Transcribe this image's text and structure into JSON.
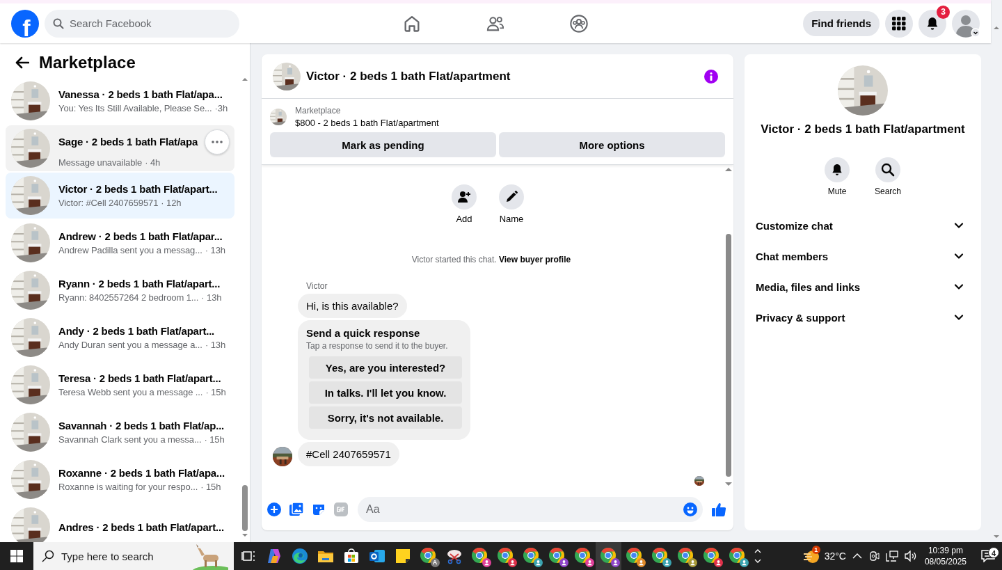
{
  "topbar": {
    "logo": "f",
    "search": {
      "placeholder": "Search Facebook"
    },
    "find_friends": "Find friends",
    "notifications_badge": "3"
  },
  "sidebar": {
    "title": "Marketplace",
    "conversations": [
      {
        "title": "Vanessa · 2 beds 1 bath Flat/apa...",
        "preview": "You: Yes Its Still Available, Please Se...",
        "time": "·3h",
        "selected": false,
        "hovered": false
      },
      {
        "title": "Sage · 2 beds 1 bath Flat/apa",
        "preview": "Message unavailable",
        "time": "· 4h",
        "selected": false,
        "hovered": true
      },
      {
        "title": "Victor · 2 beds 1 bath Flat/apart...",
        "preview": "Victor: #Cell 2407659571",
        "time": "· 12h",
        "selected": true,
        "hovered": false
      },
      {
        "title": "Andrew · 2 beds 1 bath Flat/apar...",
        "preview": "Andrew Padilla sent you a messag...",
        "time": "· 13h",
        "selected": false,
        "hovered": false
      },
      {
        "title": "Ryann · 2 beds 1 bath Flat/apart...",
        "preview": "Ryann: 8402557264 2 bedroom 1...",
        "time": "· 13h",
        "selected": false,
        "hovered": false
      },
      {
        "title": "Andy · 2 beds 1 bath Flat/apart...",
        "preview": "Andy Duran sent you a message a...",
        "time": "· 13h",
        "selected": false,
        "hovered": false
      },
      {
        "title": "Teresa · 2 beds 1 bath Flat/apart...",
        "preview": "Teresa Webb sent you a message ...",
        "time": "· 15h",
        "selected": false,
        "hovered": false
      },
      {
        "title": "Savannah · 2 beds 1 bath Flat/ap...",
        "preview": "Savannah Clark sent you a messa...",
        "time": "· 15h",
        "selected": false,
        "hovered": false
      },
      {
        "title": "Roxanne · 2 beds 1 bath Flat/apa...",
        "preview": "Roxanne is waiting for your respo...",
        "time": "· 15h",
        "selected": false,
        "hovered": false
      },
      {
        "title": "Andres · 2 beds 1 bath Flat/apart...",
        "selected": false,
        "hovered": false
      }
    ]
  },
  "chat": {
    "title": "Victor · 2 beds 1 bath Flat/apartment",
    "listing": {
      "label": "Marketplace",
      "text": "$800 - 2 beds 1 bath Flat/apartment"
    },
    "actions": [
      "Mark as pending",
      "More options"
    ],
    "profile_actions": [
      {
        "kind": "add",
        "label": "Add"
      },
      {
        "kind": "name",
        "label": "Name"
      }
    ],
    "system": {
      "text": "Victor started this chat.",
      "link": "View buyer profile"
    },
    "sender": "Victor",
    "messages": [
      {
        "kind": "text",
        "text": "Hi, is this available?",
        "avatar": false
      },
      {
        "kind": "quick_response",
        "title": "Send a quick response",
        "subtitle": "Tap a response to send it to the buyer.",
        "options": [
          "Yes, are you interested?",
          "In talks. I'll let you know.",
          "Sorry, it's not available."
        ]
      },
      {
        "kind": "text",
        "text": "#Cell 2407659571",
        "avatar": true
      }
    ],
    "composer": {
      "placeholder": "Aa"
    }
  },
  "info": {
    "title": "Victor · 2 beds 1 bath Flat/apartment",
    "actions": [
      {
        "kind": "mute",
        "label": "Mute"
      },
      {
        "kind": "search",
        "label": "Search"
      }
    ],
    "sections": [
      {
        "label": "Customize chat",
        "expanded": false
      },
      {
        "label": "Chat members",
        "expanded": false
      },
      {
        "label": "Media, files and links",
        "expanded": false
      },
      {
        "label": "Privacy & support",
        "expanded": false
      }
    ]
  },
  "taskbar": {
    "search": {
      "placeholder": "Type here to search"
    },
    "apps": [
      {
        "kind": "taskview",
        "selected": false
      },
      {
        "kind": "copilot",
        "selected": false
      },
      {
        "kind": "edge",
        "selected": false
      },
      {
        "kind": "explorer",
        "selected": false
      },
      {
        "kind": "store",
        "selected": false
      },
      {
        "kind": "outlook",
        "selected": false
      },
      {
        "kind": "sticky",
        "selected": false
      },
      {
        "kind": "chrome",
        "letter": "A",
        "color": "#7a7a7a",
        "selected": false
      },
      {
        "kind": "snip",
        "selected": false
      },
      {
        "kind": "chrome",
        "color": "#e0409a",
        "selected": false
      },
      {
        "kind": "chrome",
        "color": "#e0304a",
        "selected": false
      },
      {
        "kind": "chrome",
        "color": "#3aa3b0",
        "selected": false
      },
      {
        "kind": "chrome",
        "color": "#8e44c9",
        "selected": false
      },
      {
        "kind": "chrome",
        "color": "#e0409a",
        "selected": false
      },
      {
        "kind": "chrome",
        "color": "#8e44c9",
        "selected": true
      },
      {
        "kind": "chrome",
        "color": "#e08a2a",
        "selected": false
      },
      {
        "kind": "chrome",
        "color": "#3aa3b0",
        "selected": false
      },
      {
        "kind": "chrome",
        "color": "#a89a3a",
        "selected": false
      },
      {
        "kind": "chrome",
        "color": "#e0304a",
        "selected": false
      },
      {
        "kind": "chrome",
        "color": "#3aa3b0",
        "selected": false
      }
    ],
    "weather": {
      "temp": "32°C",
      "badge": "1"
    },
    "time": "10:39 pm",
    "date": "08/05/2025",
    "notifications": "4"
  }
}
